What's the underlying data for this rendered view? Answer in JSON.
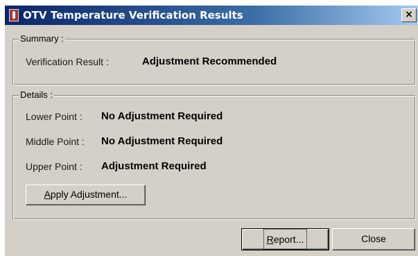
{
  "window": {
    "title": "OTV Temperature Verification Results",
    "close_glyph": "×"
  },
  "summary": {
    "group_label": "Summary :",
    "result_label": "Verification Result :",
    "result_value": "Adjustment Recommended"
  },
  "details": {
    "group_label": "Details :",
    "points": [
      {
        "label": "Lower Point :",
        "value": "No Adjustment Required"
      },
      {
        "label": "Middle Point :",
        "value": "No Adjustment Required"
      },
      {
        "label": "Upper Point :",
        "value": "Adjustment Required"
      }
    ],
    "apply_button": {
      "mnemonic": "A",
      "rest": "pply Adjustment..."
    }
  },
  "footer": {
    "report_button": {
      "mnemonic": "R",
      "rest": "eport..."
    },
    "close_button": "Close"
  },
  "icons": {
    "title_icon": "thermometer-icon",
    "close_icon": "close-icon"
  }
}
